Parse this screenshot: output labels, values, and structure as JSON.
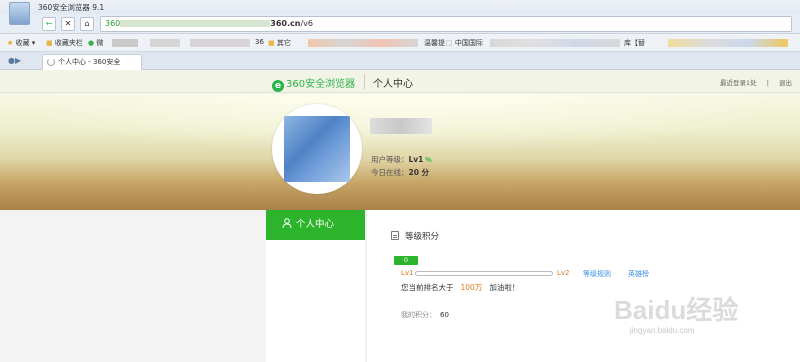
{
  "window": {
    "title": "360安全浏览器 9.1"
  },
  "address_bar": {
    "prefix": "360",
    "host": "360.cn",
    "path": "/v6"
  },
  "bookmarks": [
    {
      "label": "收藏",
      "icon": "star-icon"
    },
    {
      "label": "收藏夹栏",
      "icon": "folder-icon"
    },
    {
      "label": "微",
      "icon": "wechat-icon"
    },
    {
      "label": "36",
      "icon": ""
    },
    {
      "label": "其它",
      "icon": "folder-icon"
    },
    {
      "label": "温馨提",
      "icon": ""
    },
    {
      "label": "中国国际",
      "icon": "page-icon"
    },
    {
      "label": "库【替",
      "icon": ""
    }
  ],
  "tab": {
    "label": "个人中心 - 360安全"
  },
  "site": {
    "logo_text": "360安全浏览器",
    "header_title": "个人中心",
    "last_login": "最近登录1处",
    "logout": "退出"
  },
  "profile": {
    "level_label": "用户等级：",
    "level_value": "Lv1",
    "online_label": "今日在线：",
    "online_value": "20 分"
  },
  "sidebar": {
    "active_item": "个人中心"
  },
  "level_section": {
    "title": "等级积分",
    "score": "0",
    "level_from": "Lv1",
    "level_to": "Lv2",
    "progress": 0,
    "rules_link": "等级规则",
    "ranking_link": "英雄榜",
    "rank_prefix": "您当前排名大于",
    "rank_value": "100万",
    "rank_suffix": "加油啦！",
    "my_score_label": "我的积分：",
    "my_score_value": "60"
  },
  "watermark": {
    "brand": "Baidu经验",
    "url": "jingyan.baidu.com"
  },
  "colors": {
    "accent_green": "#2cb52c",
    "link_blue": "#3a8ee6",
    "level_orange": "#e07a20"
  }
}
